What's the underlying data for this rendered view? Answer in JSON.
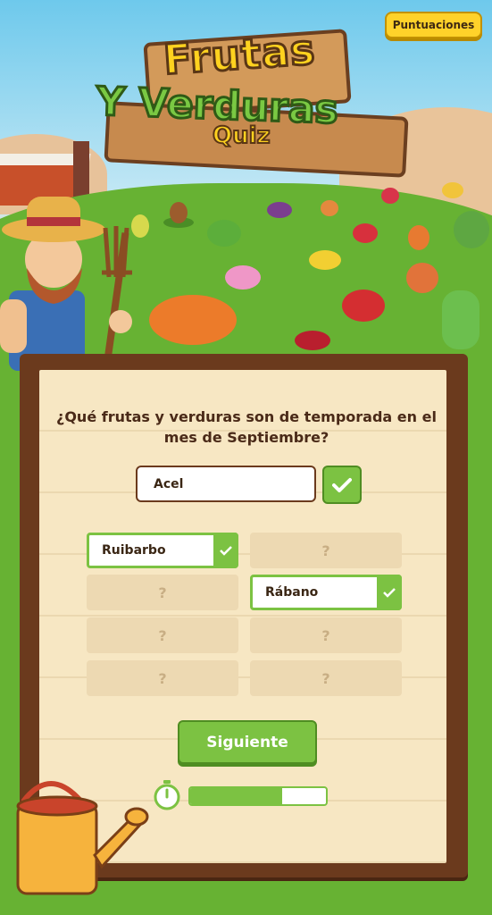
{
  "header": {
    "scores_label": "Puntuaciones"
  },
  "logo": {
    "line1": "Frutas",
    "line2": "Y Verduras",
    "line3": "Quiz"
  },
  "quiz": {
    "question": "¿Qué frutas y verduras son de temporada en el mes de Septiembre?",
    "input_value": "Acel",
    "answers": [
      {
        "label": "Ruibarbo",
        "found": true
      },
      {
        "label": "?",
        "found": false
      },
      {
        "label": "?",
        "found": false
      },
      {
        "label": "Rábano",
        "found": true
      },
      {
        "label": "?",
        "found": false
      },
      {
        "label": "?",
        "found": false
      },
      {
        "label": "?",
        "found": false
      },
      {
        "label": "?",
        "found": false
      }
    ],
    "next_label": "Siguiente",
    "time_remaining_fraction": 0.68
  },
  "colors": {
    "accent": "#7cc242",
    "board": "#f7e7c3",
    "frame": "#6b3a1d",
    "button_yellow": "#ffd22a"
  }
}
